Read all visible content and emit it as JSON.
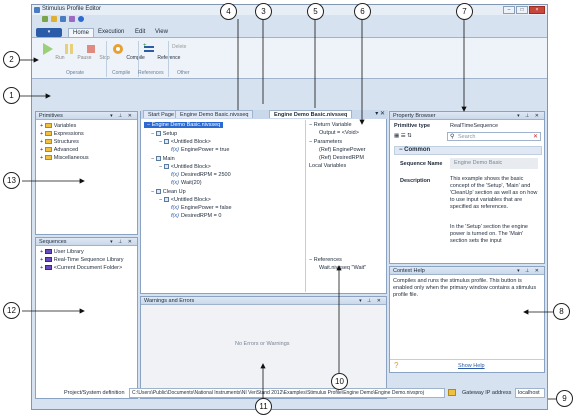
{
  "window": {
    "title": "Stimulus Profile Editor"
  },
  "ribbon": {
    "tabs": [
      "Home",
      "Execution",
      "Edit",
      "View"
    ],
    "buttons": {
      "run": "Run",
      "pause": "Pause",
      "stop": "Stop",
      "compile": "Compile",
      "reference": "Reference",
      "delete": "Delete"
    },
    "groups": {
      "operate": "Operate",
      "compile": "Compile",
      "references": "References",
      "other": "Other"
    }
  },
  "primitives": {
    "title": "Primitives",
    "items": [
      "Variables",
      "Expressions",
      "Structures",
      "Advanced",
      "Miscellaneous"
    ]
  },
  "sequences": {
    "title": "Sequences",
    "items": [
      "User Library",
      "Real-Time Sequence Library",
      "<Current Document Folder>"
    ]
  },
  "doc_tabs": [
    "Start Page",
    "Engine Demo Basic.nivsseq",
    "Engine Demo Basic.nivsseq"
  ],
  "sequence_tree": {
    "root": "Engine Demo Basic.nivsseq",
    "setup": "Setup",
    "untitled": "<Untitled Block>",
    "setup_step": "EnginePower = true",
    "main": "Main",
    "main_steps": [
      "DesiredRPM = 2500",
      "Wait(20)"
    ],
    "cleanup": "Clean Up",
    "cleanup_steps": [
      "EnginePower = false",
      "DesiredRPM = 0"
    ]
  },
  "variables": {
    "return_variable": "Return Variable",
    "output": "Output = <Void>",
    "parameters": "Parameters",
    "params": [
      "(Ref) EnginePower",
      "(Ref) DesiredRPM"
    ],
    "local_variables": "Local Variables",
    "references": "References",
    "ref_item": "Wait.nivsseq  \"Wait\""
  },
  "property_browser": {
    "title": "Property Browser",
    "primitive_type_label": "Primitive type",
    "primitive_type_value": "RealTimeSequence",
    "search_placeholder": "Search",
    "section": "Common",
    "seq_name_label": "Sequence Name",
    "seq_name_value": "Engine Demo Basic",
    "description_label": "Description",
    "description_value": "This example shows the basic concept of the 'Setup', 'Main' and 'CleanUp' section as well as on how to use input variables that are specified as references.",
    "description_value2": "In the 'Setup' section the engine power is turned on. The 'Main' section sets the input"
  },
  "context_help": {
    "title": "Context Help",
    "text": "Compiles and runs the stimulus profile. This button is enabled only when the primary window contains a stimulus profile file.",
    "link": "Show Help"
  },
  "warnings": {
    "title": "Warnings and Errors",
    "empty": "No Errors or Warnings"
  },
  "statusbar": {
    "project_label": "Project/System definition",
    "project_path": "C:\\Users\\Public\\Documents\\National Instruments\\NI VeriStand 2012\\Examples\\Stimulus Profile\\Engine Demo\\Engine Demo.nivsproj",
    "gateway_label": "Gateway IP address",
    "gateway_value": "localhost"
  },
  "callouts": [
    "1",
    "2",
    "3",
    "4",
    "5",
    "6",
    "7",
    "8",
    "9",
    "10",
    "11",
    "12",
    "13"
  ]
}
